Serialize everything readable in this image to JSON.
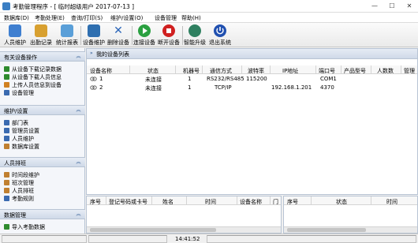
{
  "window": {
    "title": "考勤管理程序 - [ 临时超级用户 2017-07-13 ]",
    "controls": [
      "—",
      "☐",
      "✕"
    ]
  },
  "menu": [
    "数据库(D)",
    "考勤处理(E)",
    "查询/打印(S)",
    "维护/设置(O)",
    "设备管理",
    "帮助(H)"
  ],
  "toolbar": [
    {
      "label": "人员维护",
      "icon": "people-icon",
      "color": "#3f7fd0"
    },
    {
      "label": "出勤记录",
      "icon": "clock-icon",
      "color": "#d8a030"
    },
    {
      "label": "统计报表",
      "icon": "report-icon",
      "color": "#5a9fd8"
    },
    {
      "label": "设备维护",
      "icon": "device-icon",
      "color": "#2f6fb0"
    },
    {
      "label": "删除设备",
      "icon": "delete-x-icon",
      "color": "#2a64b8"
    },
    {
      "label": "连接设备",
      "icon": "connect-play-icon",
      "color": "#2aa040"
    },
    {
      "label": "断开设备",
      "icon": "disconnect-stop-icon",
      "color": "#d02020"
    },
    {
      "label": "智能升级",
      "icon": "globe-icon",
      "color": "#2f8060"
    },
    {
      "label": "退出系统",
      "icon": "power-icon",
      "color": "#2050b0"
    }
  ],
  "sidebar": {
    "sections": [
      {
        "title": "有关设备操作",
        "items": [
          {
            "label": "从设备下载记录数据",
            "icon": "download-icon",
            "color": "#2e8b2e"
          },
          {
            "label": "从设备下载人员信息",
            "icon": "download-icon",
            "color": "#2e8b2e"
          },
          {
            "label": "上传人员信息到设备",
            "icon": "upload-icon",
            "color": "#d08020"
          },
          {
            "label": "设备管理",
            "icon": "device-manage-icon",
            "color": "#3a6ab0"
          }
        ]
      },
      {
        "title": "维护/设置",
        "items": [
          {
            "label": "部门表",
            "icon": "department-icon",
            "color": "#3a6ab0"
          },
          {
            "label": "管理员设置",
            "icon": "admin-icon",
            "color": "#3a6ab0"
          },
          {
            "label": "人员维护",
            "icon": "person-icon",
            "color": "#3a6ab0"
          },
          {
            "label": "数据库设置",
            "icon": "database-icon",
            "color": "#c08030"
          }
        ]
      },
      {
        "title": "人员排班",
        "items": [
          {
            "label": "时间段维护",
            "icon": "time-period-icon",
            "color": "#c08030"
          },
          {
            "label": "班次管理",
            "icon": "shift-icon",
            "color": "#c08030"
          },
          {
            "label": "人员排班",
            "icon": "schedule-icon",
            "color": "#c08030"
          },
          {
            "label": "考勤规则",
            "icon": "rule-icon",
            "color": "#3a6ab0"
          }
        ]
      },
      {
        "title": "数据管理",
        "items": [
          {
            "label": "导入考勤数据",
            "icon": "import-icon",
            "color": "#2e8b2e"
          }
        ]
      }
    ]
  },
  "device_list": {
    "title": "我的设备列表",
    "columns": [
      "设备名称",
      "状态",
      "机器号",
      "通信方式",
      "波特率",
      "IP地址",
      "端口号",
      "产品型号",
      "人数数",
      "管理"
    ],
    "rows": [
      {
        "name": "1",
        "status": "未连接",
        "machine": "1",
        "comm": "RS232/RS485",
        "baud": "115200",
        "ip": "",
        "port": "COM1",
        "model": "",
        "count": ""
      },
      {
        "name": "2",
        "status": "未连接",
        "machine": "1",
        "comm": "TCP/IP",
        "baud": "",
        "ip": "192.168.1.201",
        "port": "4370",
        "model": "",
        "count": ""
      }
    ]
  },
  "records_table": {
    "columns": [
      "序号",
      "登记号码或卡号",
      "姓名",
      "时间",
      "设备名称",
      "门"
    ]
  },
  "log_table": {
    "columns": [
      "序号",
      "状态",
      "时间"
    ]
  },
  "status_bar": {
    "time": "14:41:52"
  }
}
